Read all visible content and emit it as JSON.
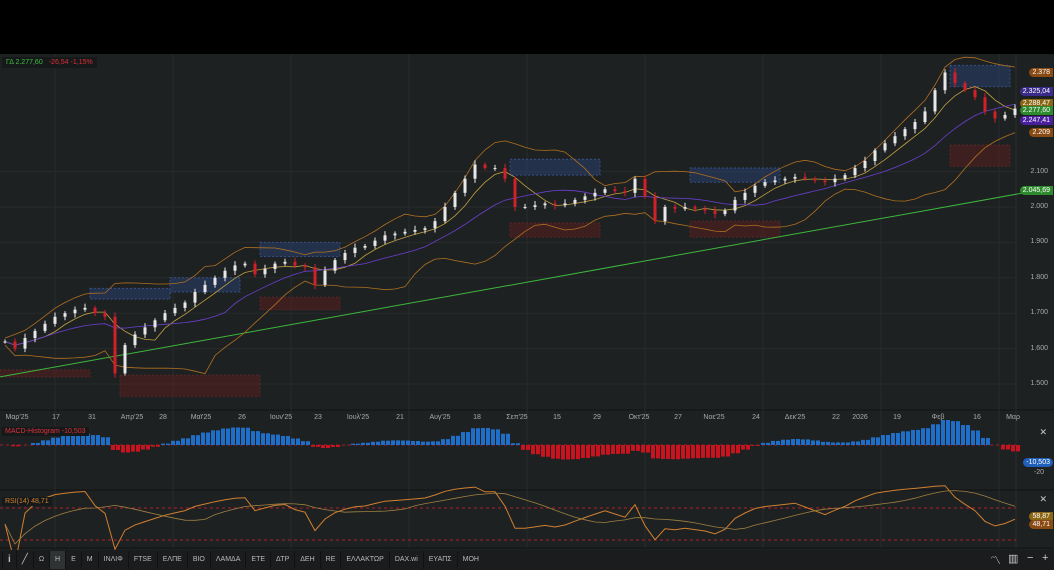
{
  "header": {
    "symbol": "ΓΔ",
    "last": "2.277,60",
    "change": "-26,54",
    "change_pct": "-1,15%"
  },
  "chart_data": {
    "type": "candlestick",
    "ylim": [
      1450,
      2400
    ],
    "y_ticks": [
      "2.100",
      "2.000",
      "1.900",
      "1.800",
      "1.700",
      "1.600",
      "1.500"
    ],
    "y_tick_values": [
      2100,
      2000,
      1900,
      1800,
      1700,
      1600,
      1500
    ],
    "x_tick_labels": [
      "Μαρ'25",
      "17",
      "31",
      "Απρ'25",
      "28",
      "Μαϊ'25",
      "26",
      "Ιουν'25",
      "23",
      "Ιουλ'25",
      "21",
      "Αυγ'25",
      "18",
      "Σεπ'25",
      "15",
      "29",
      "Οκτ'25",
      "27",
      "Νοε'25",
      "24",
      "Δεκ'25",
      "22",
      "2026",
      "19",
      "Φεβ",
      "16",
      "Μαρ"
    ],
    "closes": [
      1620,
      1600,
      1630,
      1650,
      1670,
      1690,
      1700,
      1710,
      1715,
      1700,
      1690,
      1530,
      1610,
      1640,
      1660,
      1680,
      1700,
      1715,
      1730,
      1760,
      1780,
      1800,
      1820,
      1835,
      1840,
      1810,
      1825,
      1840,
      1845,
      1835,
      1830,
      1780,
      1820,
      1850,
      1870,
      1885,
      1890,
      1905,
      1920,
      1925,
      1930,
      1935,
      1940,
      1960,
      2000,
      2040,
      2080,
      2120,
      2110,
      2110,
      2080,
      2000,
      2000,
      2005,
      2010,
      2005,
      2010,
      2020,
      2030,
      2040,
      2050,
      2045,
      2040,
      2080,
      2030,
      1960,
      2000,
      1995,
      2000,
      1995,
      1990,
      1980,
      1990,
      2020,
      2040,
      2060,
      2070,
      2075,
      2080,
      2085,
      2080,
      2075,
      2070,
      2080,
      2090,
      2110,
      2130,
      2160,
      2180,
      2200,
      2220,
      2240,
      2270,
      2330,
      2380,
      2350,
      2330,
      2310,
      2270,
      2250,
      2260,
      2278
    ],
    "sma200": {
      "start": 1520,
      "end": 2045.69
    },
    "zones": [
      {
        "type": "supply",
        "from": 95,
        "to": 101,
        "low": 2340,
        "high": 2400
      },
      {
        "type": "demand",
        "from": 95,
        "to": 101,
        "low": 2115,
        "high": 2175
      },
      {
        "type": "supply",
        "from": 51,
        "to": 60,
        "low": 2090,
        "high": 2135
      },
      {
        "type": "demand",
        "from": 51,
        "to": 60,
        "low": 1915,
        "high": 1955
      },
      {
        "type": "supply",
        "from": 69,
        "to": 78,
        "low": 2070,
        "high": 2110
      },
      {
        "type": "demand",
        "from": 69,
        "to": 78,
        "low": 1915,
        "high": 1960
      },
      {
        "type": "supply",
        "from": 26,
        "to": 34,
        "low": 1860,
        "high": 1900
      },
      {
        "type": "demand",
        "from": 26,
        "to": 34,
        "low": 1710,
        "high": 1745
      },
      {
        "type": "supply",
        "from": 17,
        "to": 24,
        "low": 1760,
        "high": 1800
      },
      {
        "type": "demand",
        "from": 12,
        "to": 26,
        "low": 1465,
        "high": 1525
      },
      {
        "type": "demand",
        "from": 0,
        "to": 9,
        "low": 1520,
        "high": 1540
      },
      {
        "type": "supply",
        "from": 9,
        "to": 17,
        "low": 1740,
        "high": 1770
      }
    ],
    "price_tags": [
      {
        "text": "2.378",
        "value": 2378,
        "color": "#8a4a14"
      },
      {
        "text": "2.325,04",
        "value": 2325,
        "color": "#3a2a8a"
      },
      {
        "text": "2.288,47",
        "value": 2290,
        "color": "#8a6514"
      },
      {
        "text": "2.277,60",
        "value": 2270,
        "color": "#2e8a2e"
      },
      {
        "text": "2.247,41",
        "value": 2243,
        "color": "#4a1f9e"
      },
      {
        "text": "2.209",
        "value": 2209,
        "color": "#8a4a14"
      },
      {
        "text": "2.045,69",
        "value": 2045.69,
        "color": "#2e8a2e"
      }
    ]
  },
  "macd": {
    "label": "MACD-Histogram",
    "value": "-10,503",
    "tick": "-20"
  },
  "rsi": {
    "label": "RSI(14)",
    "value": "48,71",
    "ma_value": "58,87"
  },
  "toolbar": {
    "items": [
      "Ω",
      "Η",
      "Ε",
      "Μ",
      "ΙΝΛΙΦ",
      "FTSE",
      "ΕΛΠΕ",
      "ΒΙΟ",
      "ΛΑΜΔΑ",
      "ΕΤΕ",
      "ΔΤΡ",
      "ΔΕΗ",
      "RE",
      "ΕΛΛΑΚΤΩΡ",
      "DAX.wi",
      "ΕΥΑΠΣ",
      "ΜΟΗ"
    ],
    "active": "Η"
  },
  "colors": {
    "up": "#e8e8e8",
    "down": "#d0202a",
    "sma200": "#3cb83c",
    "bb": "#b07020",
    "ma_fast": "#c0a040",
    "ma_slow": "#6a40d0",
    "macd_pos": "#1f6fc8",
    "macd_neg": "#c8141e",
    "rsi": "#d08030"
  }
}
